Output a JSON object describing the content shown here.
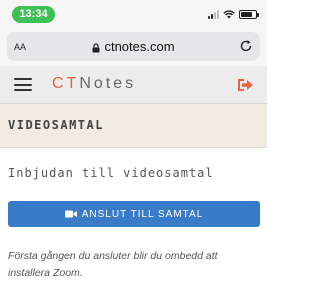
{
  "status_bar": {
    "time": "13:34",
    "battery_level": 0.8
  },
  "browser": {
    "aa_label": "AA",
    "url": "ctnotes.com"
  },
  "site_header": {
    "logo_ct": "CT",
    "logo_notes": "Notes"
  },
  "section": {
    "title": "VIDEOSAMTAL"
  },
  "main": {
    "heading": "Inbjudan till videosamtal",
    "join_button_label": "ANSLUT TILL SAMTAL",
    "info_text": "Första gången du ansluter blir du ombedd att installera Zoom."
  },
  "colors": {
    "accent": "#3a7bc8",
    "logo_accent": "#e8643f",
    "logout_icon": "#e8643f",
    "time_pill": "#3fbf55"
  }
}
